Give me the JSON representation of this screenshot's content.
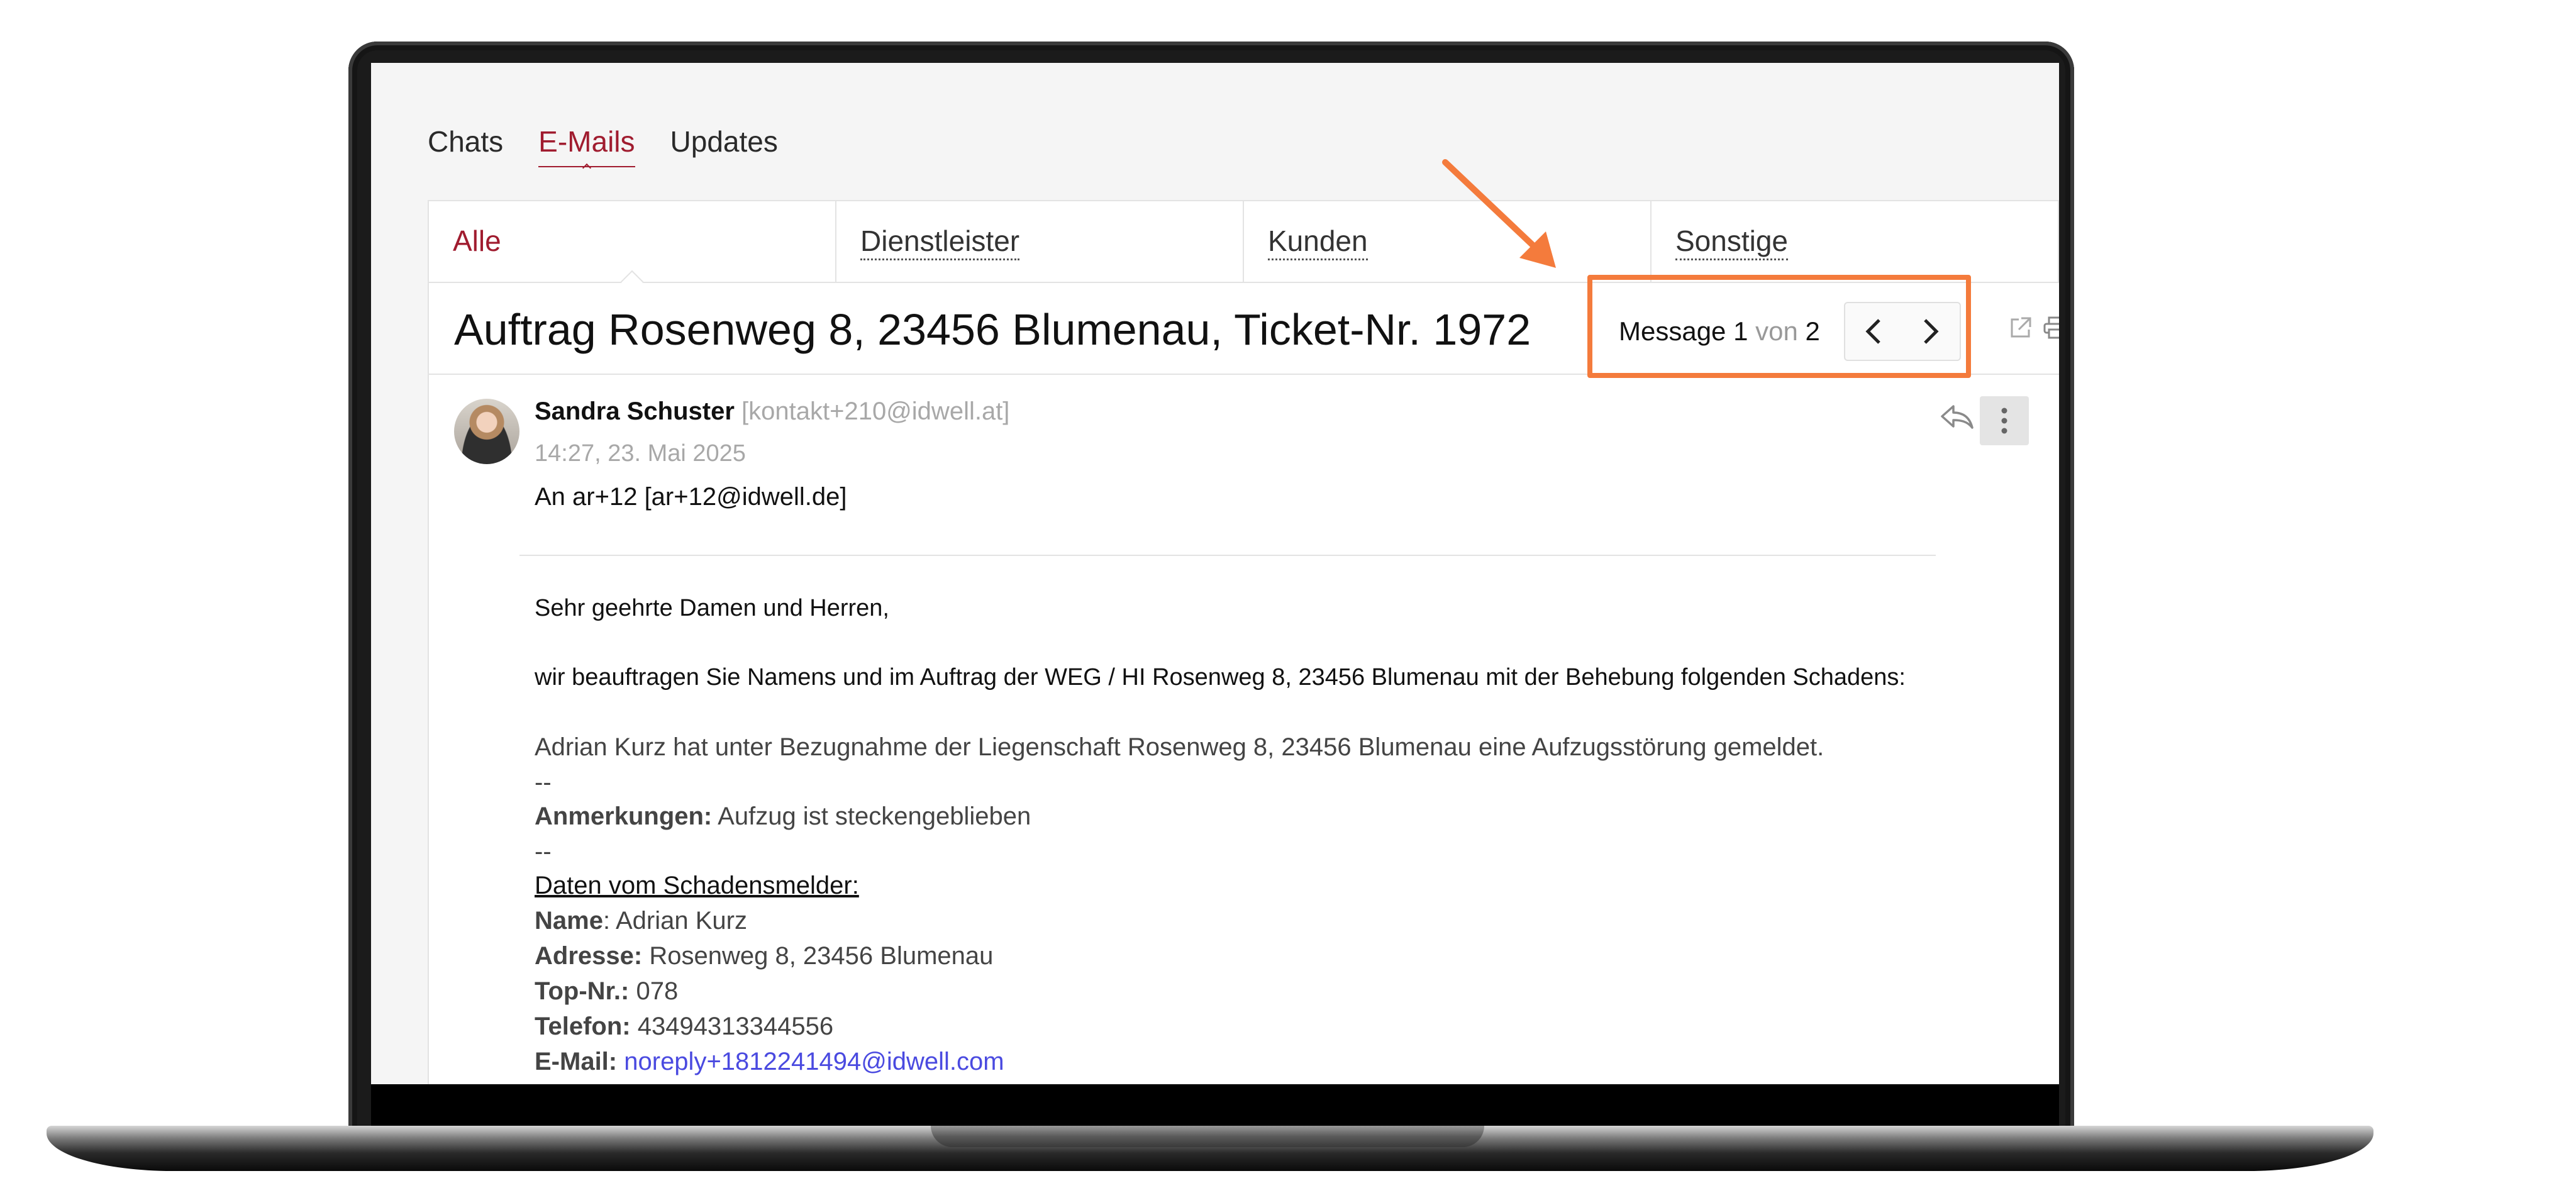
{
  "top_tabs": [
    {
      "label": "Chats"
    },
    {
      "label": "E-Mails"
    },
    {
      "label": "Updates"
    }
  ],
  "sub_tabs": [
    {
      "label": "Alle"
    },
    {
      "label": "Dienstleister"
    },
    {
      "label": "Kunden"
    },
    {
      "label": "Sonstige"
    }
  ],
  "subject": "Auftrag Rosenweg 8, 23456 Blumenau, Ticket-Nr. 1972",
  "pager": {
    "word": "Message",
    "current": "1",
    "sep": "von",
    "total": "2"
  },
  "message": {
    "sender_name": "Sandra Schuster",
    "sender_email": "[kontakt+210@idwell.at]",
    "timestamp": "14:27, 23. Mai 2025",
    "to_line": "An ar+12 [ar+12@idwell.de]"
  },
  "body": {
    "greeting": "Sehr geehrte Damen und Herren,",
    "intro": "wir beauftragen Sie Namens und im Auftrag der WEG / HI Rosenweg 8, 23456 Blumenau mit der Behebung folgenden Schadens:",
    "report": "Adrian Kurz hat unter Bezugnahme der Liegenschaft Rosenweg 8, 23456 Blumenau eine Aufzugsstörung gemeldet.",
    "sep1": "--",
    "remarks_label": "Anmerkungen:",
    "remarks_value": "Aufzug ist steckengeblieben",
    "sep2": "--",
    "reporter_heading": "Daten vom Schadensmelder:",
    "name_label": "Name",
    "name_value": "Adrian Kurz",
    "address_label": "Adresse:",
    "address_value": "Rosenweg 8, 23456 Blumenau",
    "top_label": "Top-Nr.:",
    "top_value": "078",
    "phone_label": "Telefon:",
    "phone_value": "43494313344556",
    "email_label": "E-Mail:",
    "email_value": "noreply+1812241494@idwell.com"
  },
  "colors": {
    "accent": "#a01c2f",
    "annotation": "#f47b3c",
    "link": "#4a4ae0"
  }
}
